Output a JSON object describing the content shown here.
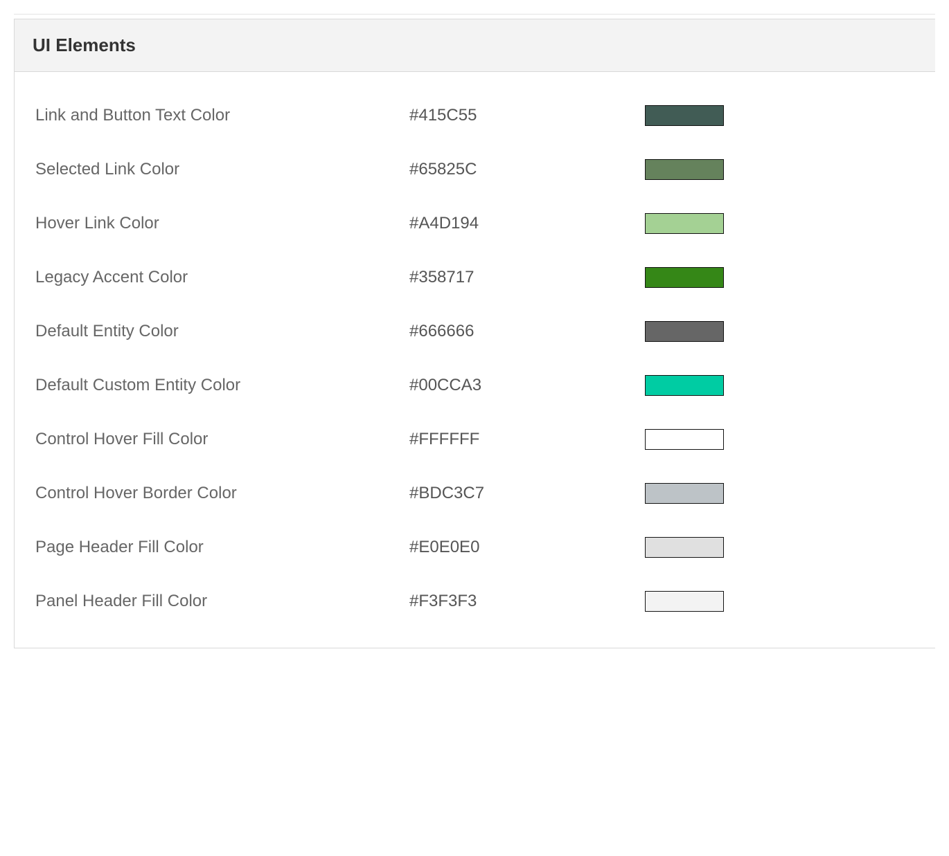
{
  "panel": {
    "title": "UI Elements",
    "rows": [
      {
        "label": "Link and Button Text Color",
        "value": "#415C55",
        "color": "#415C55"
      },
      {
        "label": "Selected Link Color",
        "value": "#65825C",
        "color": "#65825C"
      },
      {
        "label": "Hover Link Color",
        "value": "#A4D194",
        "color": "#A4D194"
      },
      {
        "label": "Legacy Accent Color",
        "value": "#358717",
        "color": "#358717"
      },
      {
        "label": "Default Entity Color",
        "value": "#666666",
        "color": "#666666"
      },
      {
        "label": "Default Custom Entity Color",
        "value": "#00CCA3",
        "color": "#00CCA3"
      },
      {
        "label": "Control Hover Fill Color",
        "value": "#FFFFFF",
        "color": "#FFFFFF"
      },
      {
        "label": "Control Hover Border Color",
        "value": "#BDC3C7",
        "color": "#BDC3C7"
      },
      {
        "label": "Page Header Fill Color",
        "value": "#E0E0E0",
        "color": "#E0E0E0"
      },
      {
        "label": "Panel Header Fill Color",
        "value": "#F3F3F3",
        "color": "#F3F3F3"
      }
    ]
  }
}
